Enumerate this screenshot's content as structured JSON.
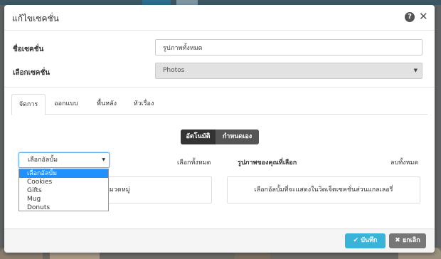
{
  "modal": {
    "title": "แก้ไขเซคชั่น",
    "help_glyph": "?",
    "close_glyph": "✕"
  },
  "form": {
    "section_name_label": "ชื่อเซคชั่น",
    "section_name_value": "รูปภาพทั้งหมด",
    "section_select_label": "เลือกเซคชั่น",
    "section_select_value": "Photos"
  },
  "tabs": [
    {
      "label": "จัดการ",
      "active": true
    },
    {
      "label": "ออกแบบ",
      "active": false
    },
    {
      "label": "พื้นหลัง",
      "active": false
    },
    {
      "label": "หัวเรื่อง",
      "active": false
    }
  ],
  "mode_toggle": {
    "auto_label": "อัตโนมัติ",
    "manual_label": "กำหนดเอง",
    "selected": "อัตโนมัติ"
  },
  "album": {
    "selected": "เลือกอัลบั้ม",
    "options": [
      "เลือกอัลบั้ม",
      "Cookies",
      "Gifts",
      "Mug",
      "Donuts"
    ],
    "highlighted_option": "เลือกอัลบั้ม",
    "select_all_link": "เลือกทั้งหมด",
    "category_hint_partial": "หมวดหมู่"
  },
  "selected_panel": {
    "title": "รูปภาพของคุณที่เลือก",
    "remove_all_link": "ลบทั้งหมด",
    "empty_message": "เลือกอัลบั้มที่จะแสดงในวิดเจ็ตเซคชั่นส่วนแกลเลอรี่"
  },
  "footer": {
    "save_label": "✔ บันทึก",
    "cancel_label": "✖ ยกเลิก"
  },
  "colors": {
    "primary_save": "#39b3d7",
    "cancel": "#777777",
    "toggle_active": "#333333",
    "dropdown_highlight": "#1e90ff"
  }
}
